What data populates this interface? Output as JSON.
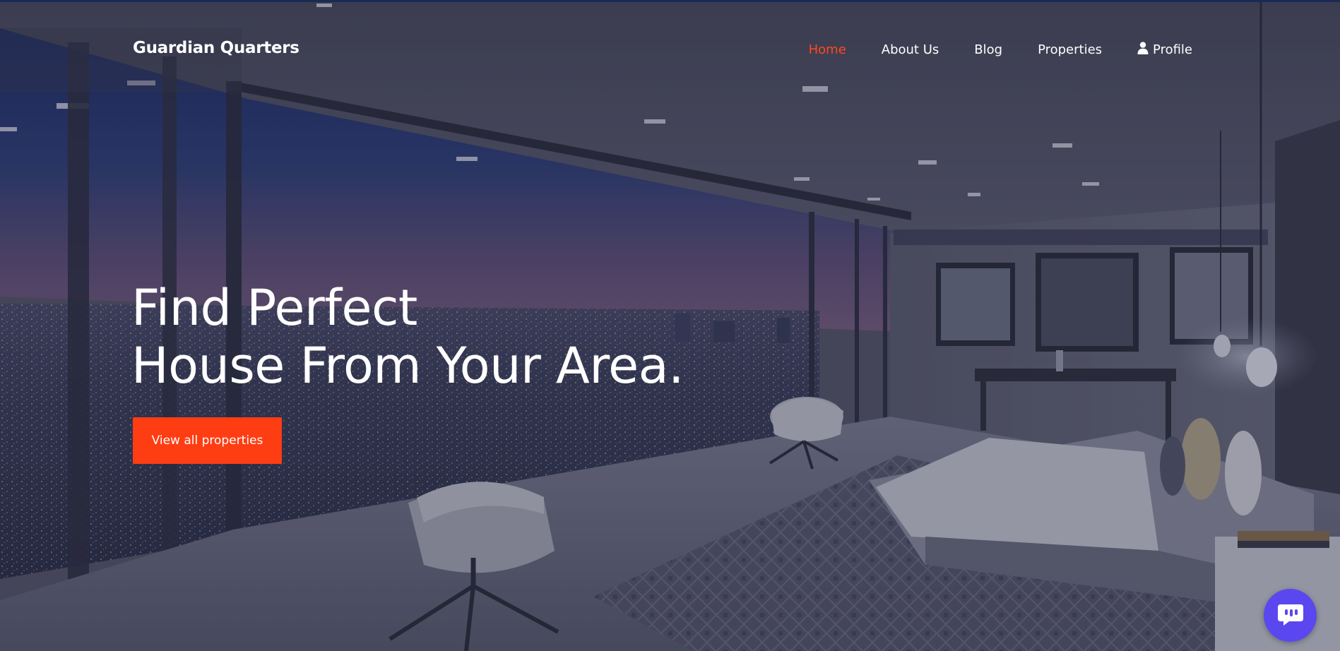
{
  "brand": {
    "name": "Guardian Quarters"
  },
  "nav": {
    "items": [
      {
        "label": "Home",
        "active": true
      },
      {
        "label": "About Us",
        "active": false
      },
      {
        "label": "Blog",
        "active": false
      },
      {
        "label": "Properties",
        "active": false
      },
      {
        "label": "Profile",
        "active": false,
        "icon": "user-icon"
      }
    ]
  },
  "hero": {
    "headline_line1": "Find Perfect",
    "headline_line2": "House From Your Area.",
    "cta_label": "View all properties",
    "background_icon": "bedroom-city-view-photo"
  },
  "chat": {
    "icon": "chat-bubble-icon"
  },
  "colors": {
    "accent": "#ff3d13",
    "nav_active": "#ff4a1c",
    "chat": "#5b47f0",
    "text": "#ffffff"
  }
}
